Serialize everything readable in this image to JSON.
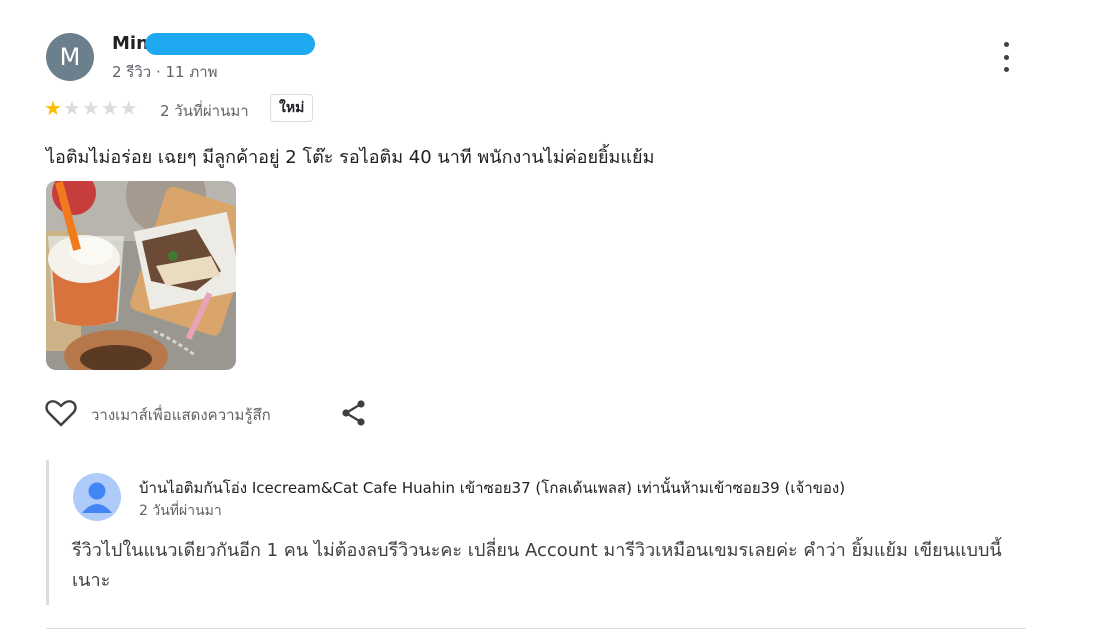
{
  "reviewer": {
    "initial": "M",
    "name": "Min",
    "meta": "2 รีวิว · 11 ภาพ"
  },
  "rating": {
    "value": 1,
    "max": 5,
    "filled_color": "#fbbc04",
    "empty_color": "#dadce0"
  },
  "review_date": "2 วันที่ผ่านมา",
  "badge": "ใหม่",
  "review_text": "ไอติมไม่อร่อย เฉยๆ มีลูกค้าอยู่ 2 โต๊ะ รอไอติม 40 นาที พนักงานไม่ค่อยยิ้มแย้ม",
  "actions": {
    "like_label": "วางเมาส์เพื่อแสดงความรู้สึก",
    "like_icon": "heart-outline-icon",
    "share_icon": "share-icon",
    "more_icon": "more-vert-icon"
  },
  "owner_reply": {
    "name": "บ้านไอติมกันโอ่ง Icecream&Cat Cafe Huahin เข้าซอย37 (โกลเด้นเพลส) เท่านั้นห้ามเข้าซอย39 (เจ้าของ)",
    "date": "2 วันที่ผ่านมา",
    "text": "รีวิวไปในแนวเดียวกันอีก 1 คน ไม่ต้องลบรีวิวนะคะ เปลี่ยน Account มารีวิวเหมือนเขมรเลยค่ะ คำว่า ยิ้มแย้ม เขียนแบบนี้เนาะ"
  }
}
